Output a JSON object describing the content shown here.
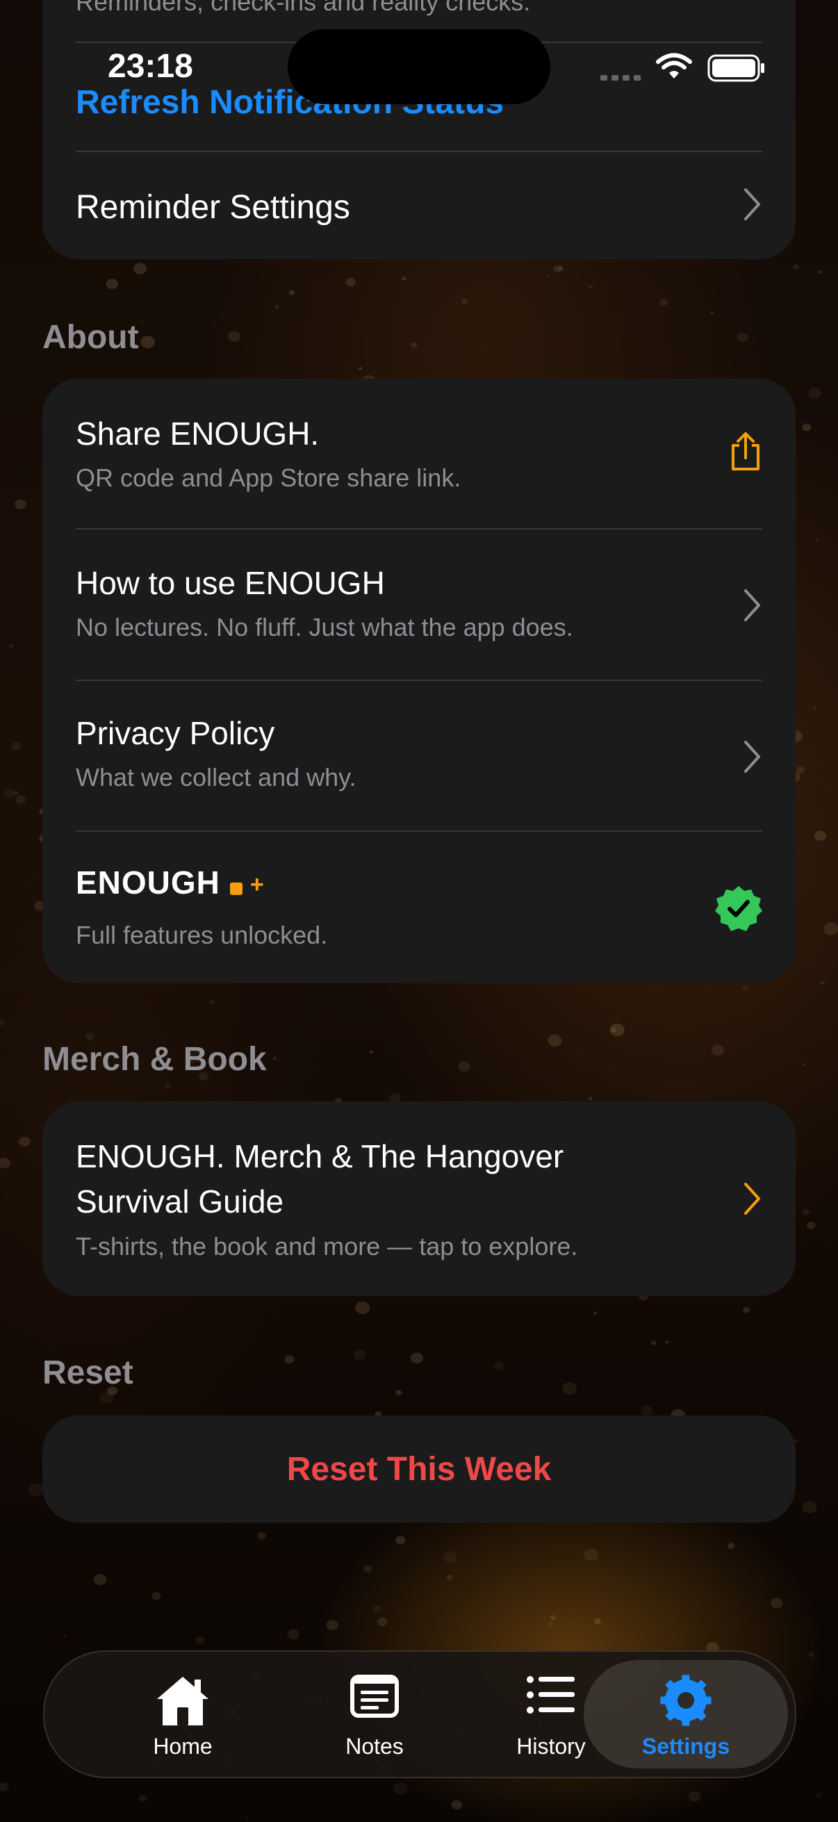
{
  "status_bar": {
    "time": "23:18"
  },
  "notifications": {
    "partial_subtitle": "Reminders, check-ins and reality checks.",
    "refresh_label": "Refresh Notification Status",
    "reminder_settings_label": "Reminder Settings"
  },
  "about": {
    "header": "About",
    "items": [
      {
        "title": "Share ENOUGH.",
        "subtitle": "QR code and App Store share link."
      },
      {
        "title": "How to use ENOUGH",
        "subtitle": "No lectures. No fluff. Just what the app does."
      },
      {
        "title": "Privacy Policy",
        "subtitle": "What we collect and why."
      }
    ],
    "plus": {
      "brand": "ENOUGH",
      "subtitle": "Full features unlocked."
    }
  },
  "merch": {
    "header": "Merch & Book",
    "title_line1": "ENOUGH. Merch & The Hangover",
    "title_line2": "Survival Guide",
    "subtitle": "T-shirts, the book and more — tap to explore."
  },
  "reset": {
    "header": "Reset",
    "button_label": "Reset This Week"
  },
  "tabs": [
    {
      "label": "Home",
      "icon": "house-icon"
    },
    {
      "label": "Notes",
      "icon": "notes-icon"
    },
    {
      "label": "History",
      "icon": "list-icon"
    },
    {
      "label": "Settings",
      "icon": "gear-icon",
      "selected": true
    }
  ],
  "colors": {
    "accent": "#1a8cff",
    "orange": "#f5a00a",
    "destructive": "#f04848",
    "verified": "#34c759"
  }
}
